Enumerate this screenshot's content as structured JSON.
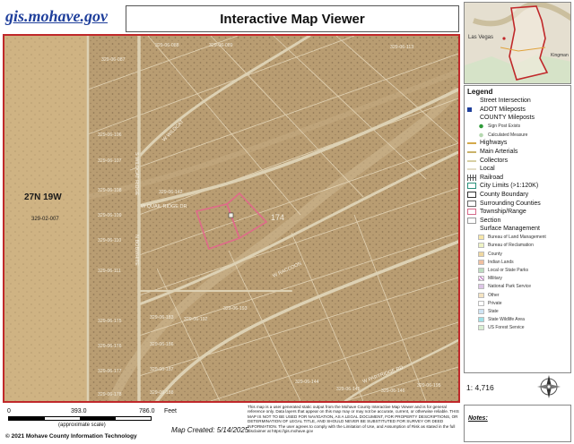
{
  "brand": {
    "text": "gis.mohave.gov",
    "color": "#1f3f9b"
  },
  "title": "Interactive Map Viewer",
  "map": {
    "frame_color": "#c0282a",
    "township_range": "27N 19W",
    "township_parcel": "329-02-007",
    "parcel_labels": [
      "329-06-087",
      "329-06-088",
      "329-06-089",
      "329-06-113",
      "329-06-106",
      "329-06-107",
      "329-06-108",
      "329-06-109",
      "329-06-110",
      "329-06-111",
      "329-06-142",
      "329-06-175",
      "329-06-176",
      "329-06-177",
      "329-06-178",
      "329-06-183",
      "329-06-186",
      "329-06-187",
      "329-06-188",
      "329-06-192",
      "329-06-193",
      "329-06-144",
      "329-06-145",
      "329-06-146",
      "329-06-195"
    ],
    "road_labels": [
      "W QUAIL RIDGE DR",
      "W WILDCAT",
      "S WILDCAT RIDGE",
      "N BOBWHITE",
      "W RACCOON",
      "W PARTRIDGE RD"
    ],
    "marker_label": "174",
    "selected_parcels_color": "#e06a8a"
  },
  "scale": {
    "ticks": [
      "0",
      "393.0",
      "786.0"
    ],
    "unit": "Feet",
    "approx_label": "(approximate scale)",
    "ratio": "1: 4,716"
  },
  "created": "Map Created: 5/14/2025",
  "copyright": "© 2021 Mohave County Information Technology",
  "disclaimer": "This map is a user generated static output from the Mohave County Interactive Map Viewer and is for general reference only. Data layers that appear on this map may or may not be accurate, current, or otherwise reliable. THIS MAP IS NOT TO BE USED FOR NAVIGATION, AS A LEGAL DOCUMENT, FOR PROPERTY DESCRIPTIONS, OR DETERMINATION OF LEGAL TITLE, AND SHOULD NEVER BE SUBSTITUTED FOR SURVEY OR DEED INFORMATION. The user agrees to comply with the Limitation of Use, and Assumption of Risk as stated in the full disclaimer at https://gis.mohave.gov",
  "inset": {
    "city1": "Las Vegas",
    "city2": "Kingman"
  },
  "legend": {
    "title": "Legend",
    "items": [
      {
        "label": "Street Intersection",
        "kind": "head",
        "swatch": "none",
        "color": "#000"
      },
      {
        "label": "ADOT Mileposts",
        "kind": "head",
        "swatch": "square",
        "color": "#1f3f9b"
      },
      {
        "label": "COUNTY Mileposts",
        "kind": "head",
        "swatch": "none",
        "color": "#000"
      },
      {
        "label": "Sign Post Exists",
        "kind": "sub",
        "swatch": "dot",
        "color": "#2f9a3a"
      },
      {
        "label": "Calculated Measure",
        "kind": "sub",
        "swatch": "dot",
        "color": "#b5d8b0"
      },
      {
        "label": "Highways",
        "kind": "head",
        "swatch": "line",
        "color": "#d4a94a"
      },
      {
        "label": "Main Arterials",
        "kind": "head",
        "swatch": "line",
        "color": "#c9b26a"
      },
      {
        "label": "Collectors",
        "kind": "head",
        "swatch": "line",
        "color": "#d7cfa3"
      },
      {
        "label": "Local",
        "kind": "head",
        "swatch": "line",
        "color": "#e3ddc6"
      },
      {
        "label": "Railroad",
        "kind": "head",
        "swatch": "rail",
        "color": "#555"
      },
      {
        "label": "City Limits (>1:120K)",
        "kind": "head",
        "swatch": "box",
        "color": "#2a8f7a"
      },
      {
        "label": "County Boundary",
        "kind": "head",
        "swatch": "box",
        "color": "#333"
      },
      {
        "label": "Surrounding Counties",
        "kind": "head",
        "swatch": "box",
        "color": "#666"
      },
      {
        "label": "Township/Range",
        "kind": "head",
        "swatch": "box",
        "color": "#d66a8a"
      },
      {
        "label": "Section",
        "kind": "head",
        "swatch": "box",
        "color": "#999"
      },
      {
        "label": "Surface Management",
        "kind": "head",
        "swatch": "none",
        "color": "#000"
      },
      {
        "label": "Bureau of Land Management",
        "kind": "sub",
        "swatch": "fill",
        "color": "#f6e6a8"
      },
      {
        "label": "Bureau of Reclamation",
        "kind": "sub",
        "swatch": "fill",
        "color": "#eef3c4"
      },
      {
        "label": "County",
        "kind": "sub",
        "swatch": "fill",
        "color": "#efd7a0"
      },
      {
        "label": "Indian Lands",
        "kind": "sub",
        "swatch": "fill",
        "color": "#f0bfa0"
      },
      {
        "label": "Local or State Parks",
        "kind": "sub",
        "swatch": "fill",
        "color": "#bcdcc0"
      },
      {
        "label": "Military",
        "kind": "sub",
        "swatch": "hatch",
        "color": "#c48ac8"
      },
      {
        "label": "National Park Service",
        "kind": "sub",
        "swatch": "fill",
        "color": "#dcc4e6"
      },
      {
        "label": "Other",
        "kind": "sub",
        "swatch": "fill",
        "color": "#f4e3c2"
      },
      {
        "label": "Private",
        "kind": "sub",
        "swatch": "fill",
        "color": "#ffffff"
      },
      {
        "label": "State",
        "kind": "sub",
        "swatch": "fill",
        "color": "#cfe4f4"
      },
      {
        "label": "State Wildlife Area",
        "kind": "sub",
        "swatch": "fill",
        "color": "#9fe0e6"
      },
      {
        "label": "US Forest Service",
        "kind": "sub",
        "swatch": "fill",
        "color": "#d9efd2"
      }
    ]
  },
  "notes_label": "Notes:"
}
